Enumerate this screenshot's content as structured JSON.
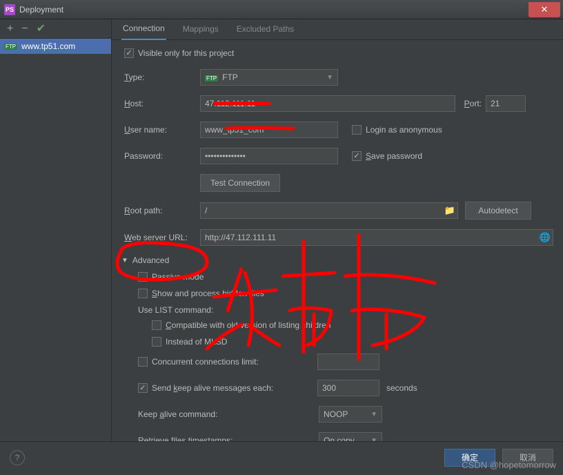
{
  "window": {
    "title": "Deployment"
  },
  "left": {
    "server_name": "www.tp51.com"
  },
  "tabs": {
    "connection": "Connection",
    "mappings": "Mappings",
    "excluded": "Excluded Paths"
  },
  "form": {
    "visible_only": "Visible only for this project",
    "type_label": "Type:",
    "type_value": "FTP",
    "host_label": "Host:",
    "host_value": "47.112.111.11",
    "port_label": "Port:",
    "port_value": "21",
    "user_label": "User name:",
    "user_value": "www_tp51_com",
    "login_anon": "Login as anonymous",
    "password_label": "Password:",
    "password_value": "••••••••••••••",
    "save_password": "Save password",
    "test_btn": "Test Connection",
    "root_label": "Root path:",
    "root_value": "/",
    "autodetect": "Autodetect",
    "web_url_label": "Web server URL:",
    "web_url_value": "http://47.112.111.11",
    "advanced": "Advanced",
    "passive": "Passive mode",
    "show_hidden": "Show and process hidden files",
    "use_list": "Use  LIST command:",
    "compat": "Compatible with old version of listing children",
    "instead_mlsd": "Instead of MLSD",
    "concurrent": "Concurrent connections limit:",
    "keep_alive": "Send keep alive messages each:",
    "keep_alive_value": "300",
    "seconds": "seconds",
    "keep_cmd_label": "Keep alive command:",
    "keep_cmd_value": "NOOP",
    "retrieve_label": "Retrieve files timestamps:",
    "retrieve_value": "On copy"
  },
  "footer": {
    "ok": "确定",
    "cancel": "取消"
  },
  "watermark": "CSDN @hopetomorrow"
}
